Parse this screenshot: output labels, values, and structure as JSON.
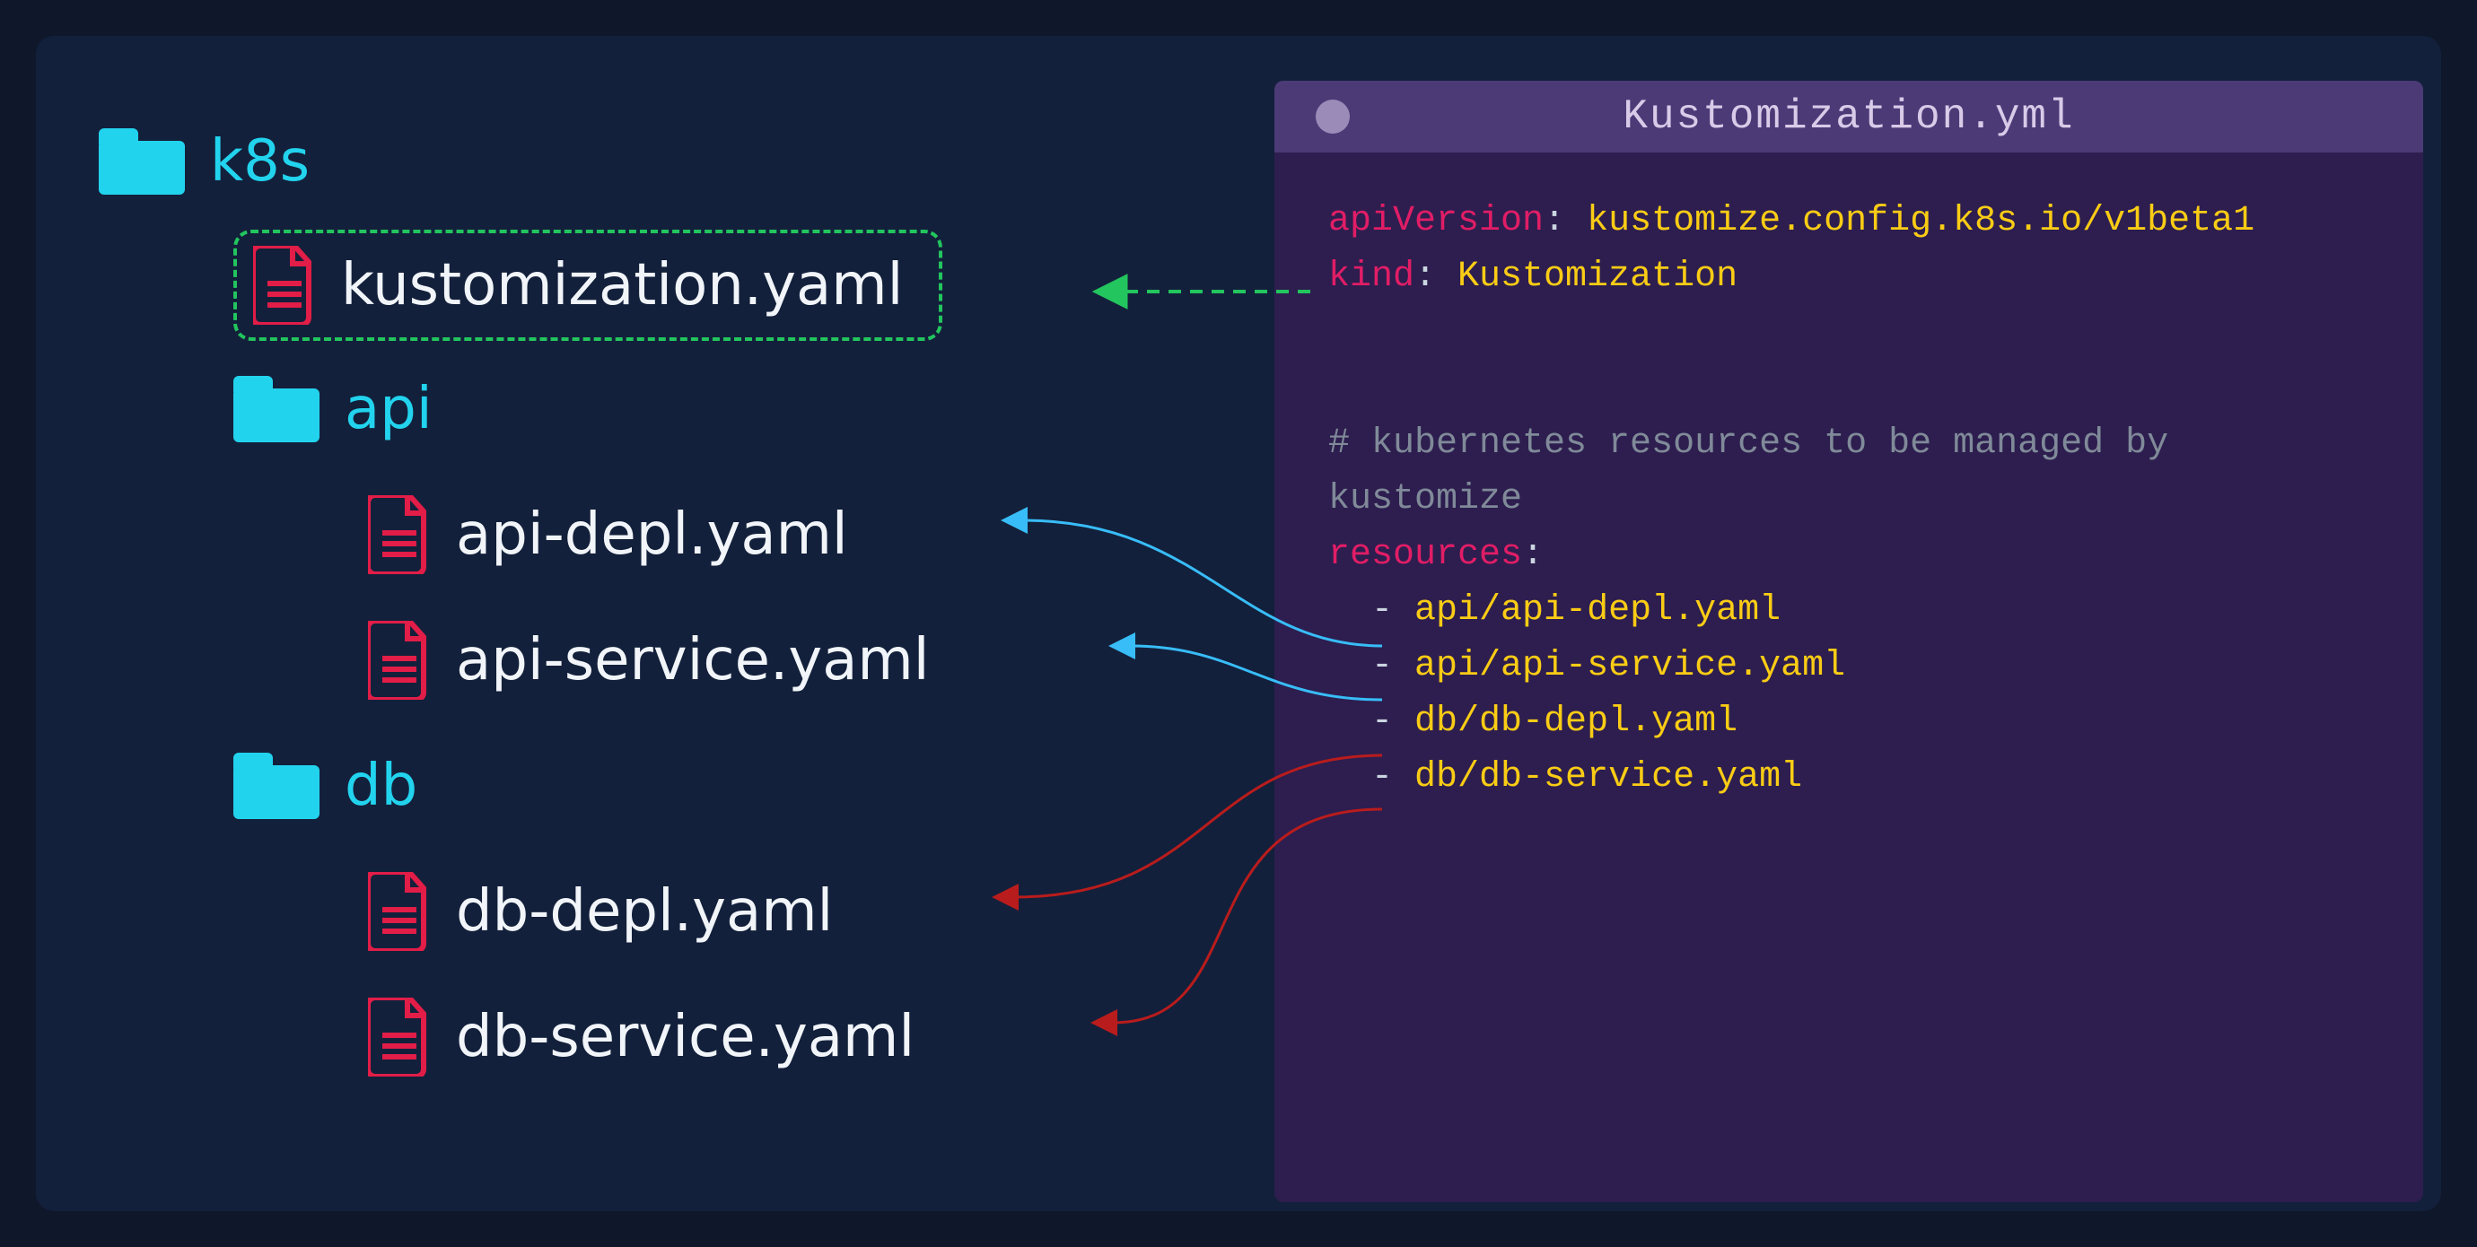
{
  "tree": {
    "root": "k8s",
    "kustomization_file": "kustomization.yaml",
    "folders": [
      {
        "name": "api",
        "files": [
          "api-depl.yaml",
          "api-service.yaml"
        ]
      },
      {
        "name": "db",
        "files": [
          "db-depl.yaml",
          "db-service.yaml"
        ]
      }
    ]
  },
  "code": {
    "title": "Kustomization.yml",
    "lines": {
      "apiVersion_key": "apiVersion",
      "apiVersion_val": "kustomize.config.k8s.io/v1beta1",
      "kind_key": "kind",
      "kind_val": "Kustomization",
      "comment": "# kubernetes resources to be managed by kustomize",
      "resources_key": "resources",
      "resources": [
        "api/api-depl.yaml",
        "api/api-service.yaml",
        "db/db-depl.yaml",
        "db/db-service.yaml"
      ]
    }
  },
  "colors": {
    "folder_icon": "#22d3ee",
    "file_icon": "#e11d48",
    "highlight_border": "#22c55e",
    "arrow_green": "#22c55e",
    "arrow_blue": "#38bdf8",
    "arrow_red": "#b91c1c"
  }
}
